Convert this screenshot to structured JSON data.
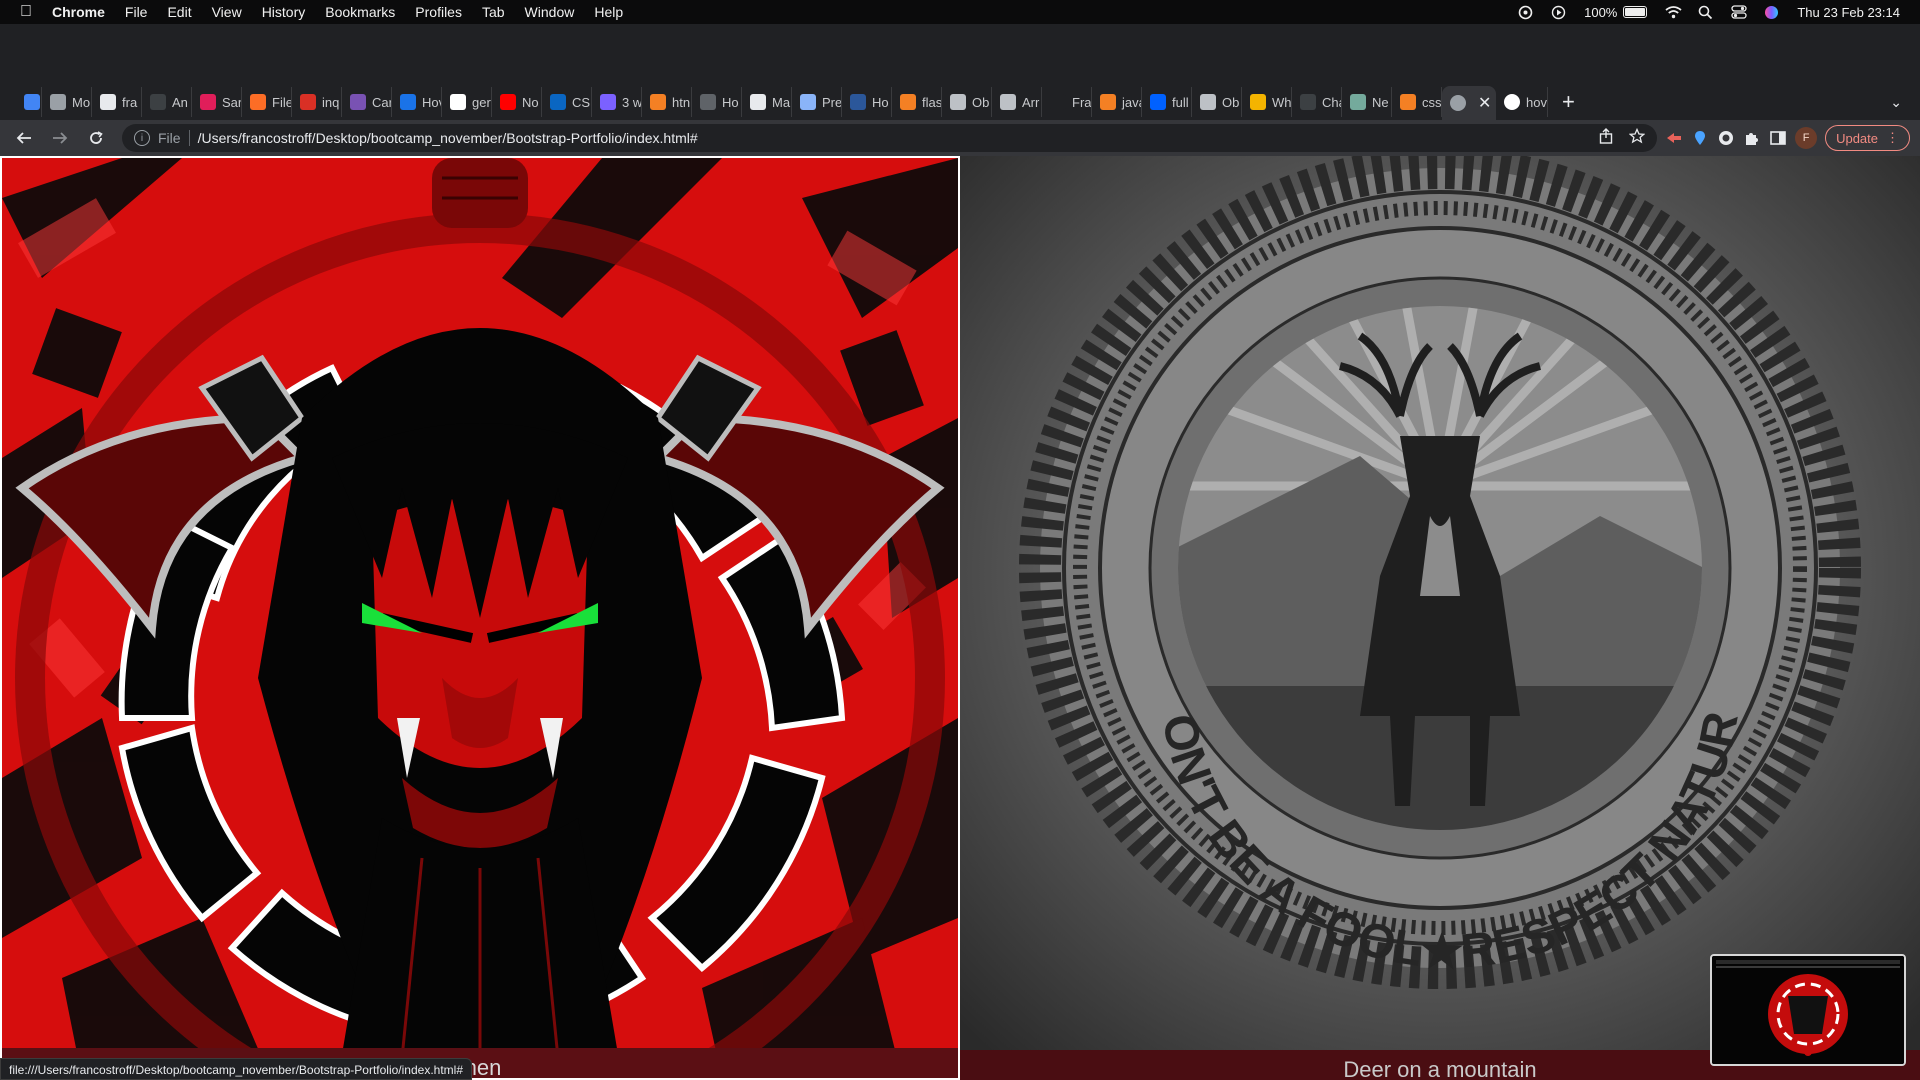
{
  "menubar": {
    "app": "Chrome",
    "items": [
      "File",
      "Edit",
      "View",
      "History",
      "Bookmarks",
      "Profiles",
      "Tab",
      "Window",
      "Help"
    ],
    "battery": "100%",
    "clock": "Thu 23 Feb  23:14"
  },
  "tabs": [
    {
      "label": "",
      "color": "#4285f4"
    },
    {
      "label": "Mo",
      "color": "#9aa0a6"
    },
    {
      "label": "fra",
      "color": "#e8eaed"
    },
    {
      "label": "An",
      "color": "#3c4043"
    },
    {
      "label": "Sar",
      "color": "#e01e5a"
    },
    {
      "label": "File",
      "color": "#fc6d26"
    },
    {
      "label": "inq",
      "color": "#d93025"
    },
    {
      "label": "Car",
      "color": "#7952b3"
    },
    {
      "label": "Hov",
      "color": "#1a73e8"
    },
    {
      "label": "ger",
      "color": "#ffffff"
    },
    {
      "label": "No",
      "color": "#ff0000"
    },
    {
      "label": "CS",
      "color": "#0a66c2"
    },
    {
      "label": "3 w",
      "color": "#7b61ff"
    },
    {
      "label": "htn",
      "color": "#f48024"
    },
    {
      "label": "Ho",
      "color": "#5f6368"
    },
    {
      "label": "Ma",
      "color": "#e8eaed"
    },
    {
      "label": "Pre",
      "color": "#8ab4f8"
    },
    {
      "label": "Ho",
      "color": "#2b579a"
    },
    {
      "label": "flas",
      "color": "#f48024"
    },
    {
      "label": "Ob",
      "color": "#bdc1c6"
    },
    {
      "label": "Arr",
      "color": "#bdc1c6"
    },
    {
      "label": "Fra",
      "color": "#202124"
    },
    {
      "label": "java",
      "color": "#f48024"
    },
    {
      "label": "full",
      "color": "#0061ff"
    },
    {
      "label": "Ob",
      "color": "#bdc1c6"
    },
    {
      "label": "Wh",
      "color": "#f4b400"
    },
    {
      "label": "Cha",
      "color": "#3c4043"
    },
    {
      "label": "Ne",
      "color": "#74aa9c"
    },
    {
      "label": "css",
      "color": "#f48024"
    }
  ],
  "active_tab": {
    "label": "",
    "close": "✕"
  },
  "last_tab": {
    "label": "hov"
  },
  "toolbar": {
    "scheme": "File",
    "url": "/Users/francostroff/Desktop/bootcamp_november/Bootstrap-Portfolio/index.html#",
    "update_label": "Update"
  },
  "cards": {
    "left_caption": "men",
    "right_caption": "Deer on a mountain",
    "right_ring_text": "DON'T BE A FOOL★RESPECT NATURE"
  },
  "status_url": "file:///Users/francostroff/Desktop/bootcamp_november/Bootstrap-Portfolio/index.html#"
}
